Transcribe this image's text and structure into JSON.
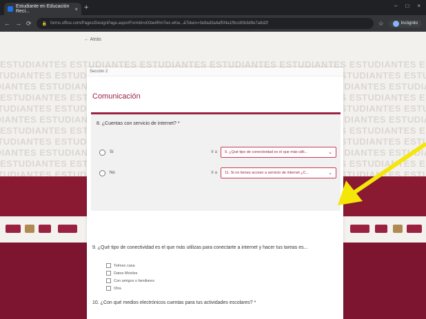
{
  "browser": {
    "tab_title": "Estudiante en Educación Reci...",
    "tab_close": "×",
    "new_tab": "+",
    "window_controls": [
      "–",
      "□",
      "×"
    ],
    "nav_icons": [
      "←",
      "→",
      "⟳"
    ],
    "url": "forms.office.com/Pages/DesignPage.aspx#FormId=dXbe4Rm7wc-eKw...&Token=3e9ad3a4af5f4a1f9cc80b3d9e7a8d2f",
    "star": "☆",
    "profile_label": "Incógnito"
  },
  "page": {
    "back_label": "← Atrás",
    "pattern_word": "ESTUDIANTES",
    "colors": {
      "band": "#8a1a32",
      "accent": "#9b2140",
      "arrow": "#f5e60a"
    }
  },
  "form": {
    "section_label": "Sección 2",
    "section_title": "Comunicación",
    "q8": {
      "text": "8. ¿Cuentas con servicio de internet? *",
      "options": [
        {
          "label": "Sí",
          "goto": "Ir a",
          "destination": "9. ¿Qué tipo de conectividad es el que más utili..."
        },
        {
          "label": "No",
          "goto": "Ir a",
          "destination": "11. Si no tienes acceso a servicio de internet ¿C..."
        }
      ]
    },
    "q9": {
      "text": "9. ¿Qué tipo de conectividad es el que más utilizas para conectarte a internet y hacer tus tareas es...",
      "options": [
        "Telmex casa",
        "Datos Móviles",
        "Con amigos o familiares",
        "Otra"
      ]
    },
    "q10": {
      "text": "10. ¿Con qué medios electrónicos cuentas para tus actividades escolares? *"
    }
  }
}
